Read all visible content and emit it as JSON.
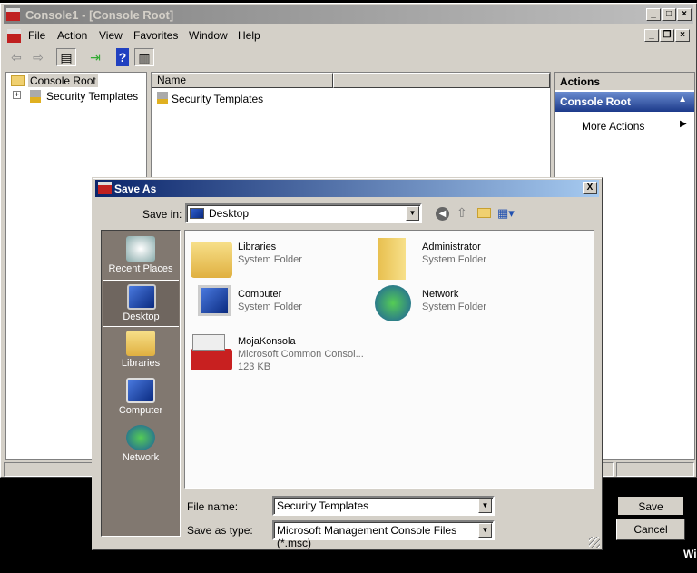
{
  "window": {
    "title": "Console1 - [Console Root]",
    "menu": [
      "File",
      "Action",
      "View",
      "Favorites",
      "Window",
      "Help"
    ]
  },
  "tree": {
    "root": "Console Root",
    "child": "Security Templates",
    "expander": "+"
  },
  "list": {
    "column": "Name",
    "items": [
      "Security Templates"
    ]
  },
  "actions": {
    "header": "Actions",
    "section": "Console Root",
    "more": "More Actions"
  },
  "dialog": {
    "title": "Save As",
    "close": "X",
    "save_in_label": "Save in:",
    "save_in_value": "Desktop",
    "places": [
      "Recent Places",
      "Desktop",
      "Libraries",
      "Computer",
      "Network"
    ],
    "items": [
      {
        "name": "Libraries",
        "type": "System Folder"
      },
      {
        "name": "Administrator",
        "type": "System Folder"
      },
      {
        "name": "Computer",
        "type": "System Folder"
      },
      {
        "name": "Network",
        "type": "System Folder"
      },
      {
        "name": "MojaKonsola",
        "type": "Microsoft Common Consol...",
        "size": "123 KB"
      }
    ],
    "file_name_label": "File name:",
    "file_name_value": "Security Templates",
    "type_label": "Save as type:",
    "type_value": "Microsoft Management Console Files (*.msc)",
    "save": "Save",
    "cancel": "Cancel"
  },
  "taskbar_text": "Wi"
}
